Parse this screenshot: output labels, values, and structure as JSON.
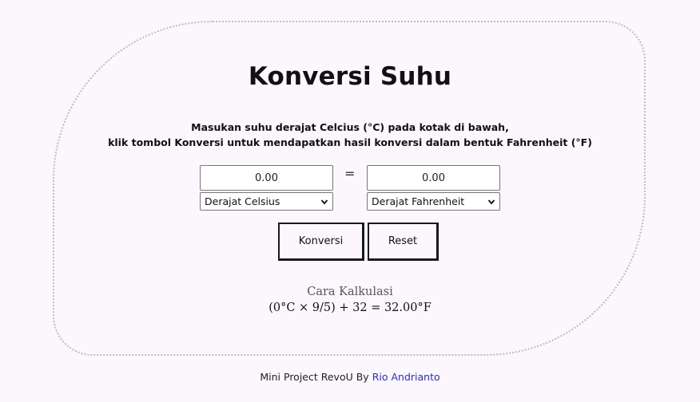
{
  "app": {
    "title": "Konversi Suhu",
    "instructions_line1": "Masukan suhu derajat Celcius (°C) pada kotak di bawah,",
    "instructions_line2": "klik tombol Konversi untuk mendapatkan hasil konversi dalam bentuk Fahrenheit (°F)"
  },
  "converter": {
    "input_value": "0.00",
    "output_value": "0.00",
    "equals_sign": "=",
    "from_unit": "Derajat Celsius",
    "to_unit": "Derajat Fahrenheit"
  },
  "buttons": {
    "convert_label": "Konversi",
    "reset_label": "Reset"
  },
  "calculation": {
    "label": "Cara Kalkulasi",
    "formula": "(0°C × 9/5) + 32 = 32.00°F"
  },
  "footer": {
    "prefix": "Mini Project RevoU By",
    "author_link": "Rio Andrianto"
  },
  "colors": {
    "background": "#fbf7fd",
    "link": "#2c2cc9",
    "border_dotted": "#bdbdbd"
  }
}
